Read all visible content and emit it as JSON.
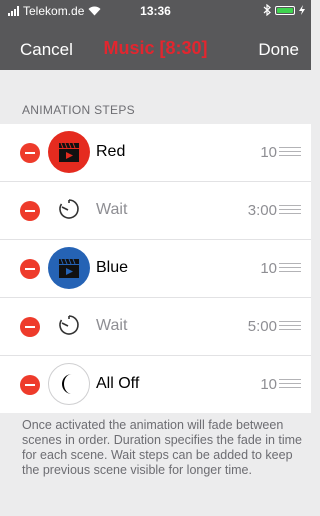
{
  "status": {
    "carrier": "Telekom.de",
    "time": "13:36"
  },
  "nav": {
    "cancel_label": "Cancel",
    "title": "Music [8:30]",
    "done_label": "Done"
  },
  "section": {
    "header": "ANIMATION STEPS"
  },
  "steps": [
    {
      "label": "Red",
      "duration": "10",
      "icon": "red-scene-icon"
    },
    {
      "label": "Wait",
      "duration": "3:00",
      "icon": "timer-icon"
    },
    {
      "label": "Blue",
      "duration": "10",
      "icon": "blue-scene-icon"
    },
    {
      "label": "Wait",
      "duration": "5:00",
      "icon": "timer-icon"
    },
    {
      "label": "All Off",
      "duration": "10",
      "icon": "moon-icon"
    }
  ],
  "footer": {
    "text": "Once activated the animation will fade between scenes in order. Duration specifies the fade in time for each scene. Wait steps can be added to keep the previous scene visible for longer time."
  },
  "colors": {
    "nav_bg": "#58585a",
    "title": "#e2262f",
    "delete": "#ee3b2b",
    "red_scene": "#e52b1f",
    "blue_scene": "#2563b5",
    "battery": "#3fd34f"
  }
}
